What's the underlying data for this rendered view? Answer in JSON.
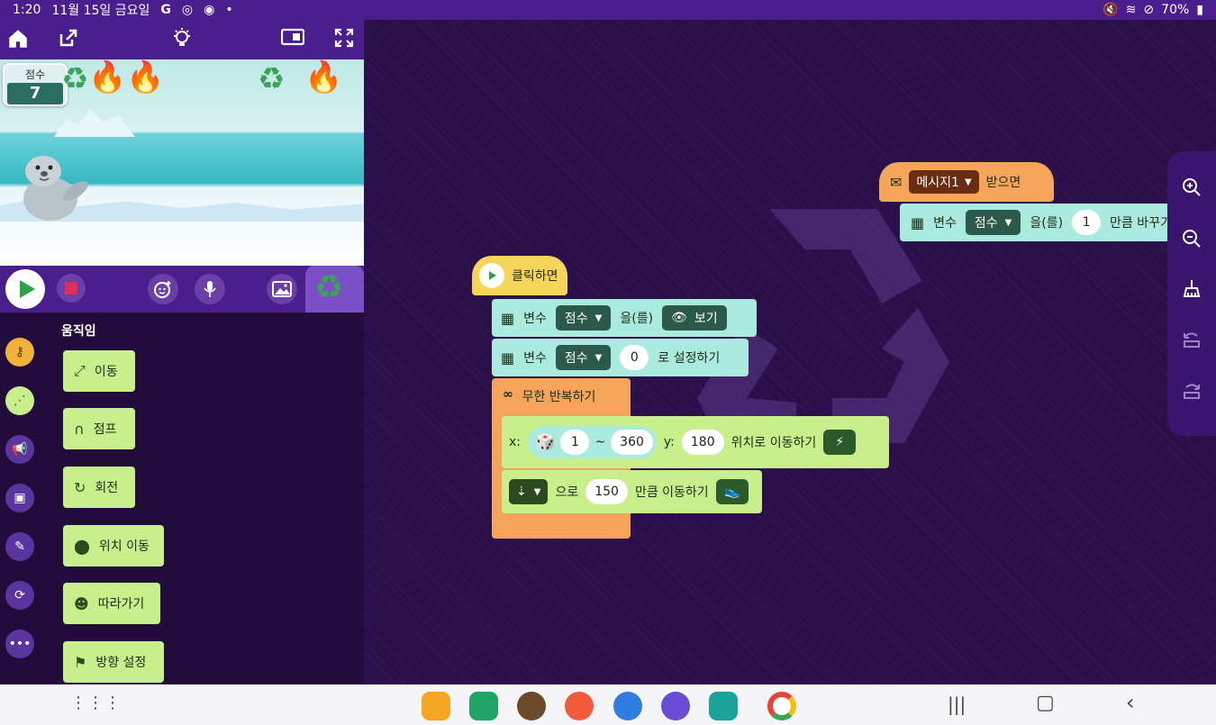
{
  "status_bar": {
    "time": "1:20",
    "date": "11월 15일 금요일",
    "battery": "70%"
  },
  "stage": {
    "score_label": "점수",
    "score_value": "7"
  },
  "palette": {
    "title": "움직임",
    "blocks": [
      "이동",
      "점프",
      "회전",
      "위치 이동",
      "따라가기",
      "방향 설정"
    ]
  },
  "workspace": {
    "script1": {
      "hat_label": "클릭하면",
      "show_var": {
        "prefix": "변수",
        "var": "점수",
        "mid": "을(를)",
        "action": "보기"
      },
      "set_var": {
        "prefix": "변수",
        "var": "점수",
        "value": "0",
        "suffix": "로 설정하기"
      },
      "forever": "무한 반복하기",
      "move_xy": {
        "x_label": "x:",
        "rand_min": "1",
        "rand_sep": "~",
        "rand_max": "360",
        "y_label": "y:",
        "y_value": "180",
        "suffix": "위치로 이동하기"
      },
      "move_dir": {
        "suffix1": "으로",
        "value": "150",
        "suffix2": "만큼 이동하기"
      }
    },
    "script2": {
      "message": "메시지1",
      "hat_suffix": "받으면",
      "change_var": {
        "prefix": "변수",
        "var": "점수",
        "mid": "을(를)",
        "value": "1",
        "suffix": "만큼 바꾸기"
      }
    }
  },
  "colors": {
    "primary_purple": "#4a1e8c",
    "workspace_bg": "#2a0f4a",
    "motion_green": "#c7f08d",
    "variable_teal": "#aaeadf",
    "control_orange": "#f5a55a",
    "event_yellow": "#f7d45a"
  }
}
